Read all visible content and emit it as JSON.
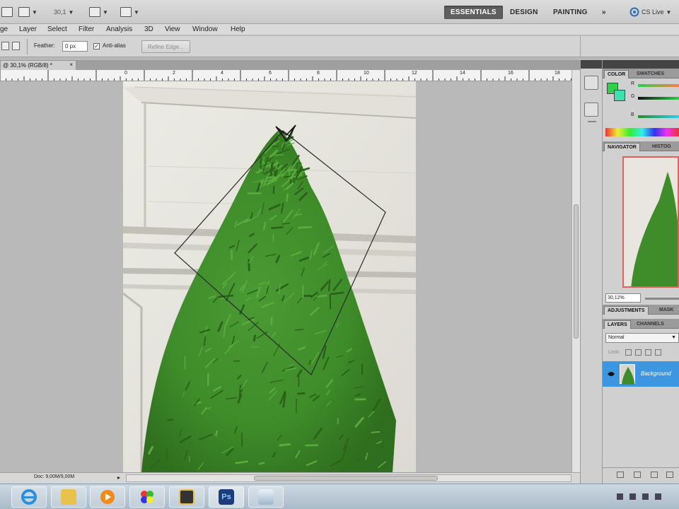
{
  "appbar": {
    "zoom": "30,1",
    "workspaces": [
      "ESSENTIALS",
      "DESIGN",
      "PAINTING"
    ],
    "more": "»",
    "cslive": "CS Live"
  },
  "menus": [
    "ge",
    "Layer",
    "Select",
    "Filter",
    "Analysis",
    "3D",
    "View",
    "Window",
    "Help"
  ],
  "options": {
    "feather_label": "Feather:",
    "feather_value": "0 px",
    "antialias_label": "Anti-alias",
    "refine_label": "Refine Edge..."
  },
  "document": {
    "tab_title": "@ 30,1% (RGB/8) *",
    "close": "×",
    "status": "Doc: 9,00M/9,00M"
  },
  "ruler": {
    "labels": [
      "0",
      "2",
      "4",
      "6",
      "8",
      "10",
      "12",
      "14",
      "16",
      "18"
    ]
  },
  "panels": {
    "color_tabs": [
      "COLOR",
      "SWATCHES"
    ],
    "color_channels": [
      "R",
      "G",
      "B"
    ],
    "navigator_tabs": [
      "NAVIGATOR",
      "HISTOG"
    ],
    "navigator_zoom": "30,12%",
    "adjust_tabs": [
      "ADJUSTMENTS",
      "MASK"
    ],
    "layers_tabs": [
      "LAYERS",
      "CHANNELS"
    ],
    "blend_mode": "Normal",
    "lock_label": "Lock:",
    "layer_name": "Background"
  },
  "taskbar": {
    "ps_label": "Ps"
  },
  "colors": {
    "foreground": "#2fd04a",
    "background": "#3fe0b0",
    "accent": "#3d96e0"
  }
}
